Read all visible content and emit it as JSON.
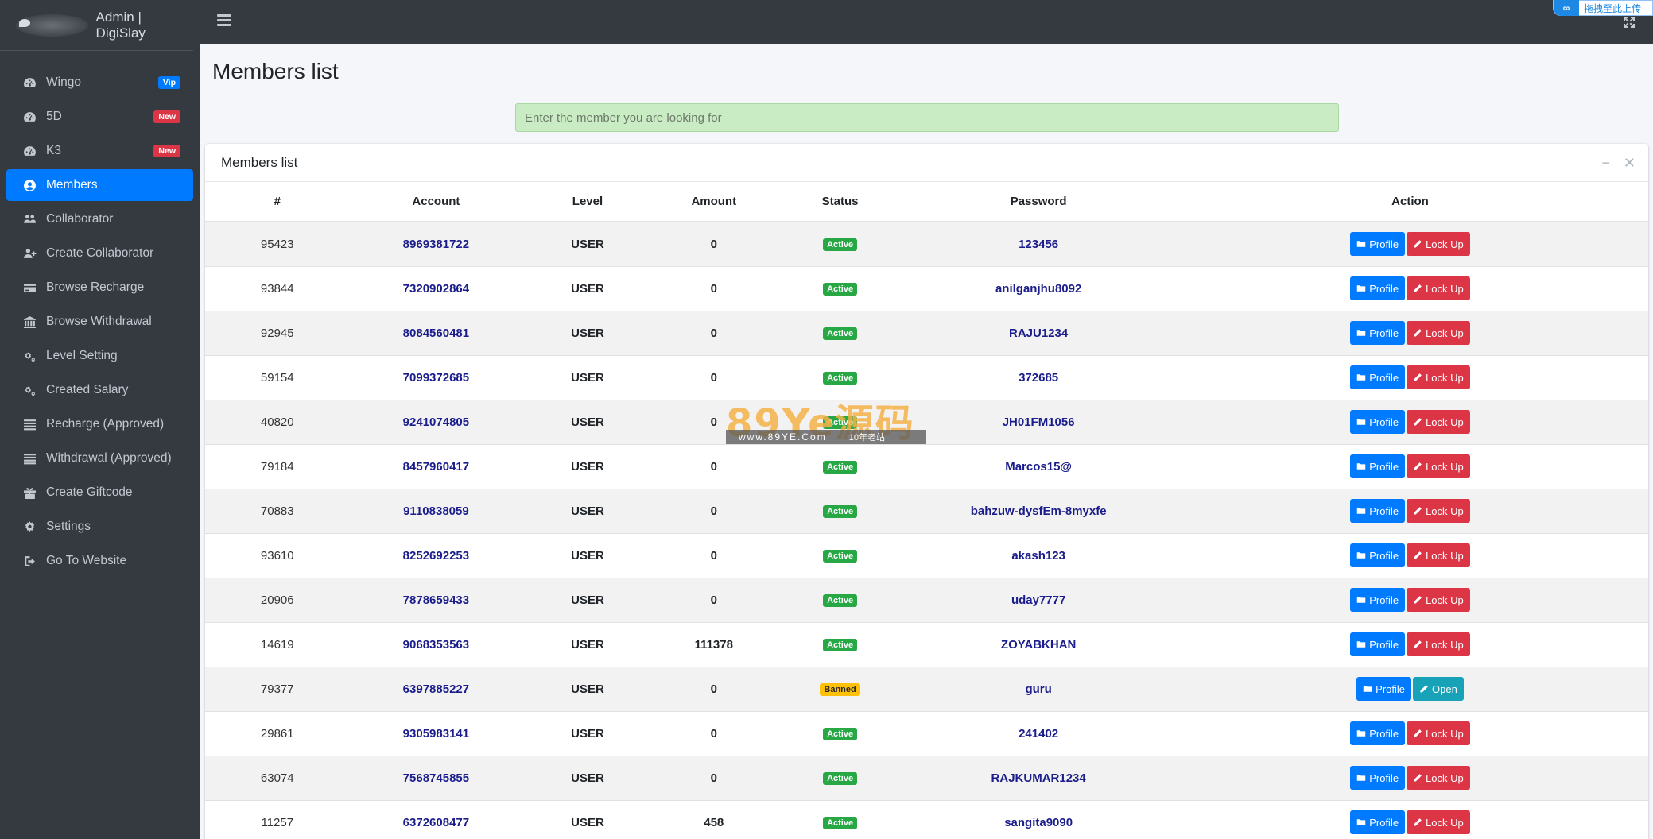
{
  "brand": {
    "logo_alt": "User Image",
    "title": "Admin | DigiSlay"
  },
  "sidebar": {
    "items": [
      {
        "label": "Wingo",
        "icon": "tachometer-icon",
        "badge": "Vip",
        "badge_type": "vip",
        "active": false
      },
      {
        "label": "5D",
        "icon": "tachometer-icon",
        "badge": "New",
        "badge_type": "new",
        "active": false
      },
      {
        "label": "K3",
        "icon": "tachometer-icon",
        "badge": "New",
        "badge_type": "new",
        "active": false
      },
      {
        "label": "Members",
        "icon": "user-circle-icon",
        "badge": "",
        "active": true
      },
      {
        "label": "Collaborator",
        "icon": "users-icon",
        "badge": "",
        "active": false
      },
      {
        "label": "Create Collaborator",
        "icon": "user-plus-icon",
        "badge": "",
        "active": false
      },
      {
        "label": "Browse Recharge",
        "icon": "credit-card-icon",
        "badge": "",
        "active": false
      },
      {
        "label": "Browse Withdrawal",
        "icon": "bank-icon",
        "badge": "",
        "active": false
      },
      {
        "label": "Level Setting",
        "icon": "cogs-icon",
        "badge": "",
        "active": false
      },
      {
        "label": "Created Salary",
        "icon": "cogs-icon",
        "badge": "",
        "active": false
      },
      {
        "label": "Recharge (Approved)",
        "icon": "list-icon",
        "badge": "",
        "active": false
      },
      {
        "label": "Withdrawal (Approved)",
        "icon": "list-icon",
        "badge": "",
        "active": false
      },
      {
        "label": "Create Giftcode",
        "icon": "gift-icon",
        "badge": "",
        "active": false
      },
      {
        "label": "Settings",
        "icon": "gear-icon",
        "badge": "",
        "active": false
      },
      {
        "label": "Go To Website",
        "icon": "sign-out-icon",
        "badge": "",
        "active": false
      }
    ]
  },
  "topbar": {
    "widget_text": "拖拽至此上传"
  },
  "page": {
    "title": "Members list",
    "search_placeholder": "Enter the member you are looking for"
  },
  "card": {
    "title": "Members list",
    "columns": [
      "#",
      "Account",
      "Level",
      "Amount",
      "Status",
      "Password",
      "Action"
    ],
    "rows": [
      {
        "id": "95423",
        "account": "8969381722",
        "level": "USER",
        "amount": "0",
        "status": "Active",
        "password": "123456",
        "action": "Lock Up"
      },
      {
        "id": "93844",
        "account": "7320902864",
        "level": "USER",
        "amount": "0",
        "status": "Active",
        "password": "anilganjhu8092",
        "action": "Lock Up"
      },
      {
        "id": "92945",
        "account": "8084560481",
        "level": "USER",
        "amount": "0",
        "status": "Active",
        "password": "RAJU1234",
        "action": "Lock Up"
      },
      {
        "id": "59154",
        "account": "7099372685",
        "level": "USER",
        "amount": "0",
        "status": "Active",
        "password": "372685",
        "action": "Lock Up"
      },
      {
        "id": "40820",
        "account": "9241074805",
        "level": "USER",
        "amount": "0",
        "status": "Active",
        "password": "JH01FM1056",
        "action": "Lock Up"
      },
      {
        "id": "79184",
        "account": "8457960417",
        "level": "USER",
        "amount": "0",
        "status": "Active",
        "password": "Marcos15@",
        "action": "Lock Up"
      },
      {
        "id": "70883",
        "account": "9110838059",
        "level": "USER",
        "amount": "0",
        "status": "Active",
        "password": "bahzuw-dysfEm-8myxfe",
        "action": "Lock Up"
      },
      {
        "id": "93610",
        "account": "8252692253",
        "level": "USER",
        "amount": "0",
        "status": "Active",
        "password": "akash123",
        "action": "Lock Up"
      },
      {
        "id": "20906",
        "account": "7878659433",
        "level": "USER",
        "amount": "0",
        "status": "Active",
        "password": "uday7777",
        "action": "Lock Up"
      },
      {
        "id": "14619",
        "account": "9068353563",
        "level": "USER",
        "amount": "111378",
        "status": "Active",
        "password": "ZOYABKHAN",
        "action": "Lock Up"
      },
      {
        "id": "79377",
        "account": "6397885227",
        "level": "USER",
        "amount": "0",
        "status": "Banned",
        "password": "guru",
        "action": "Open"
      },
      {
        "id": "29861",
        "account": "9305983141",
        "level": "USER",
        "amount": "0",
        "status": "Active",
        "password": "241402",
        "action": "Lock Up"
      },
      {
        "id": "63074",
        "account": "7568745855",
        "level": "USER",
        "amount": "0",
        "status": "Active",
        "password": "RAJKUMAR1234",
        "action": "Lock Up"
      },
      {
        "id": "11257",
        "account": "6372608477",
        "level": "USER",
        "amount": "458",
        "status": "Active",
        "password": "sangita9090",
        "action": "Lock Up"
      }
    ],
    "profile_label": "Profile"
  },
  "watermark": {
    "big": "89Ye源码",
    "url": "www.89YE.Com",
    "sub": "10年老站"
  },
  "colors": {
    "sidebar": "#343a40",
    "active": "#007bff",
    "danger": "#dc3545",
    "success": "#28a745",
    "warning": "#ffc107",
    "info": "#17a2b8"
  }
}
